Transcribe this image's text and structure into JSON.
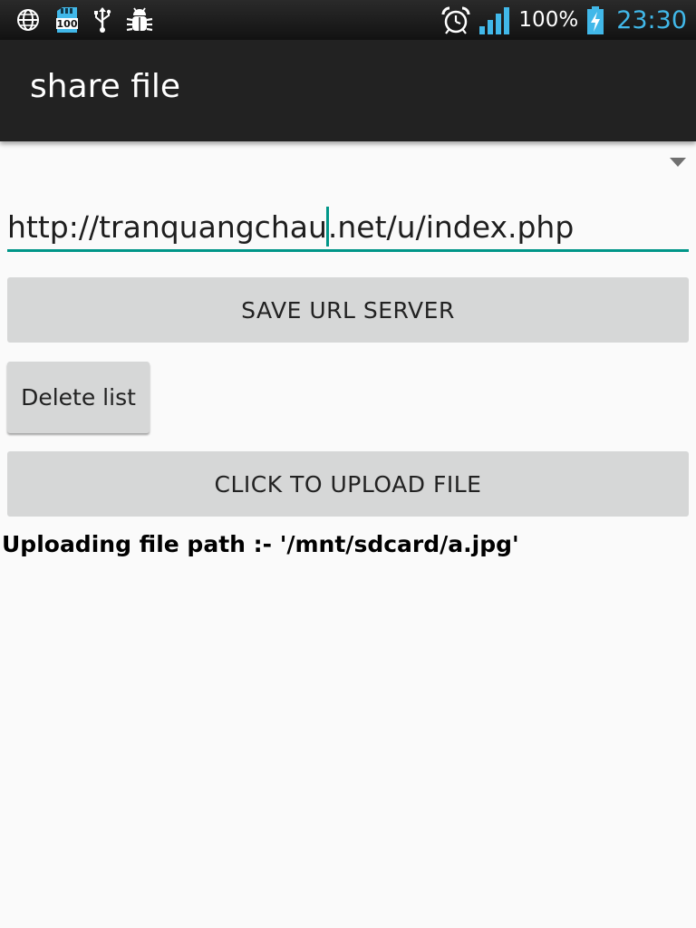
{
  "status_bar": {
    "icons_left": [
      "globe-icon",
      "sd-card-100-icon",
      "usb-icon",
      "android-debug-icon"
    ],
    "sd_card_label": "100",
    "icons_right": [
      "alarm-icon",
      "signal-icon",
      "battery-charging-icon"
    ],
    "battery_percent": "100%",
    "clock": "23:30",
    "clock_color": "#41b8e9"
  },
  "action_bar": {
    "title": "share file"
  },
  "spinner": {
    "icon": "dropdown-arrow-icon"
  },
  "url_input": {
    "value_before_caret": "http://tranquangchau",
    "value_after_caret": ".net/u/index.php",
    "accent_color": "#009688"
  },
  "buttons": {
    "save_url": "SAVE URL SERVER",
    "delete_list": "Delete list",
    "upload": "CLICK TO UPLOAD FILE"
  },
  "upload_status": "Uploading file path :- '/mnt/sdcard/a.jpg'"
}
